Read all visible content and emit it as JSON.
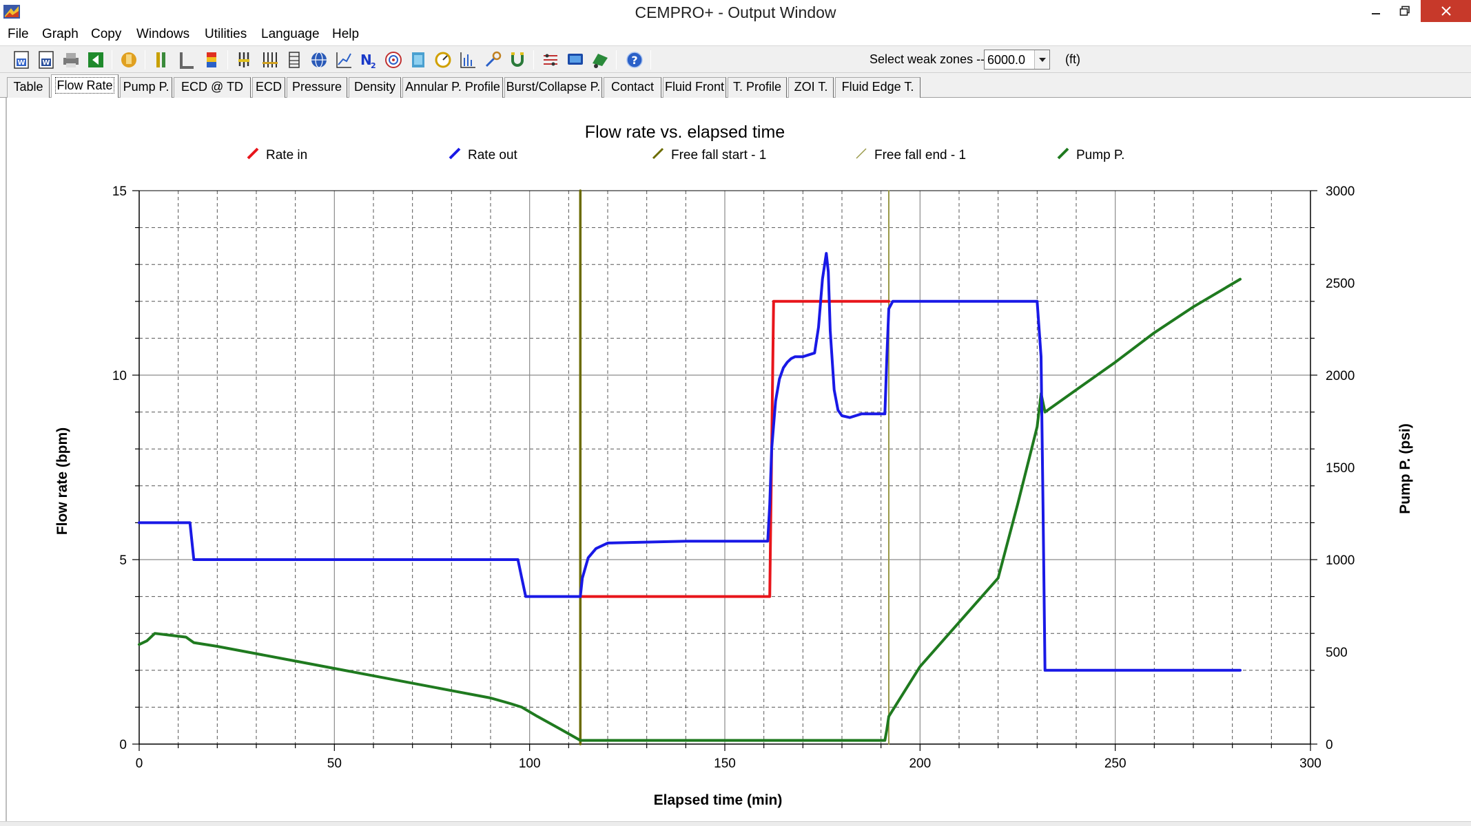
{
  "window": {
    "title": "CEMPRO+ - Output Window",
    "controls": {
      "minimize_glyph": "–",
      "restore_glyph": "❐",
      "close_glyph": "✕"
    }
  },
  "menu": [
    "File",
    "Graph",
    "Copy",
    "Windows",
    "Utilities",
    "Language",
    "Help"
  ],
  "toolbar": {
    "icons": [
      "save-w-icon",
      "save-w-alt-icon",
      "print-icon",
      "back-icon",
      "hand-icon",
      "col-chart-icon",
      "l-chart-icon",
      "color-bar-icon",
      "well-icon",
      "well-dual-icon",
      "stack-icon",
      "globe-icon",
      "line-chart-icon",
      "n2-icon",
      "target-icon",
      "map-icon",
      "gauge-icon",
      "axis-chart-icon",
      "tool-icon",
      "magnet-icon",
      "units-icon",
      "screen-icon",
      "truck-icon",
      "help-icon"
    ],
    "n2_text": "N",
    "n2_sub": "2",
    "weak_zone_label": "Select weak zones -->",
    "weak_zone_value": "6000.0",
    "weak_zone_unit": "(ft)"
  },
  "tabs": [
    "Table",
    "Flow Rate",
    "Pump P.",
    "ECD @ TD",
    "ECD",
    "Pressure",
    "Density",
    "Annular P. Profile",
    "Burst/Collapse P.",
    "Contact",
    "Fluid Front",
    "T. Profile",
    "ZOI T.",
    "Fluid Edge T."
  ],
  "active_tab": 1,
  "colors": {
    "rate_in": "#e8151b",
    "rate_out": "#1919e6",
    "free_fall_start": "#6b6b00",
    "free_fall_end": "#9a9a4a",
    "pump_p": "#1f7a1f",
    "close_button": "#c7392a"
  },
  "chart_data": {
    "type": "line",
    "title": "Flow rate vs. elapsed time",
    "xlabel": "Elapsed time (min)",
    "ylabel": "Flow rate (bpm)",
    "y2label": "Pump P. (psi)",
    "xlim": [
      0,
      300
    ],
    "ylim": [
      0,
      15
    ],
    "y2lim": [
      0,
      3000
    ],
    "xticks": [
      0,
      50,
      100,
      150,
      200,
      250,
      300
    ],
    "yticks": [
      0,
      5,
      10,
      15
    ],
    "y2ticks": [
      0,
      500,
      1000,
      1500,
      2000,
      2500,
      3000
    ],
    "grid": true,
    "legend_position": "top",
    "series": [
      {
        "name": "Rate in",
        "axis": "left",
        "x": [
          113,
          161.5,
          162.5,
          192
        ],
        "y": [
          4,
          4,
          12,
          12
        ]
      },
      {
        "name": "Rate out",
        "axis": "left",
        "x": [
          0,
          13,
          14,
          97,
          98,
          99,
          113,
          113.5,
          115,
          117,
          120,
          140,
          161,
          161.5,
          162,
          163,
          164,
          165,
          166,
          167,
          168,
          170,
          173,
          174,
          175,
          176,
          176.5,
          177,
          178,
          179,
          180,
          182,
          185,
          191,
          191.5,
          192,
          193,
          230,
          231,
          231.5,
          232,
          282
        ],
        "y": [
          6,
          6,
          5,
          5,
          4.5,
          4,
          4,
          4.5,
          5.05,
          5.3,
          5.45,
          5.5,
          5.5,
          6.5,
          8,
          9.3,
          9.9,
          10.2,
          10.35,
          10.45,
          10.5,
          10.5,
          10.6,
          11.3,
          12.6,
          13.3,
          12.8,
          11.2,
          9.6,
          9.05,
          8.9,
          8.85,
          8.95,
          8.95,
          10.5,
          11.8,
          12,
          12,
          10.5,
          6.5,
          2,
          2
        ]
      },
      {
        "name": "Free fall start - 1",
        "axis": "left",
        "x": [
          113,
          113
        ],
        "y": [
          0,
          15
        ]
      },
      {
        "name": "Free fall end - 1",
        "axis": "left",
        "x": [
          192,
          192
        ],
        "y": [
          0,
          15
        ]
      },
      {
        "name": "Pump P.",
        "axis": "right",
        "x": [
          0,
          2,
          4,
          12,
          14,
          20,
          40,
          60,
          80,
          90,
          95,
          98,
          102,
          108,
          113,
          114,
          191,
          191.5,
          192,
          200,
          210,
          220,
          225,
          230,
          231,
          232,
          240,
          250,
          260,
          270,
          282
        ],
        "y": [
          540,
          560,
          600,
          580,
          550,
          530,
          450,
          370,
          290,
          250,
          220,
          200,
          150,
          80,
          20,
          20,
          20,
          80,
          150,
          420,
          660,
          900,
          1300,
          1720,
          1900,
          1800,
          1920,
          2070,
          2230,
          2370,
          2520
        ]
      }
    ]
  }
}
